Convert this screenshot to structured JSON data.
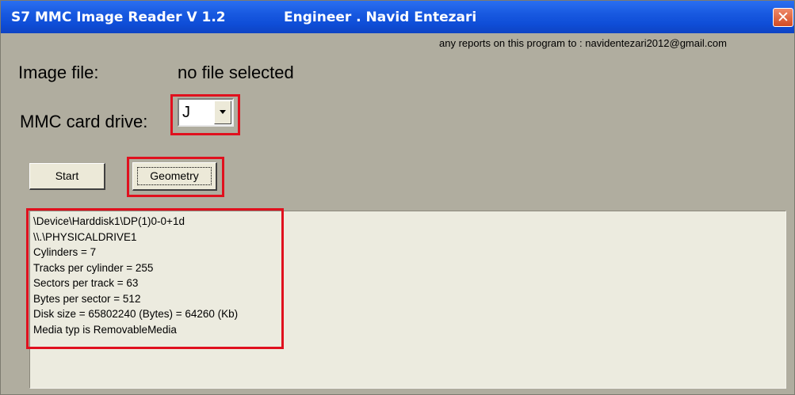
{
  "window": {
    "title": "S7 MMC Image Reader V 1.2",
    "author": "Engineer . Navid Entezari",
    "close_glyph": "✕"
  },
  "report_text": "any reports on this program to : navidentezari2012@gmail.com",
  "image_file": {
    "label": "Image file:",
    "value": "no file selected"
  },
  "mmc_drive": {
    "label": "MMC card drive:",
    "selected": "J"
  },
  "buttons": {
    "start": "Start",
    "geometry": "Geometry"
  },
  "output_lines": [
    "\\Device\\Harddisk1\\DP(1)0-0+1d",
    "\\\\.\\PHYSICALDRIVE1",
    "Cylinders = 7",
    "Tracks per cylinder = 255",
    "Sectors per track = 63",
    "Bytes per sector = 512",
    "Disk size = 65802240 (Bytes) = 64260 (Kb)",
    "Media typ is RemovableMedia"
  ],
  "colors": {
    "titlebar": "#0f4ed8",
    "highlight": "#e0101e",
    "window_bg": "#b0ad9f"
  },
  "icons": {
    "close": "close-icon",
    "dropdown": "chevron-down-icon"
  }
}
